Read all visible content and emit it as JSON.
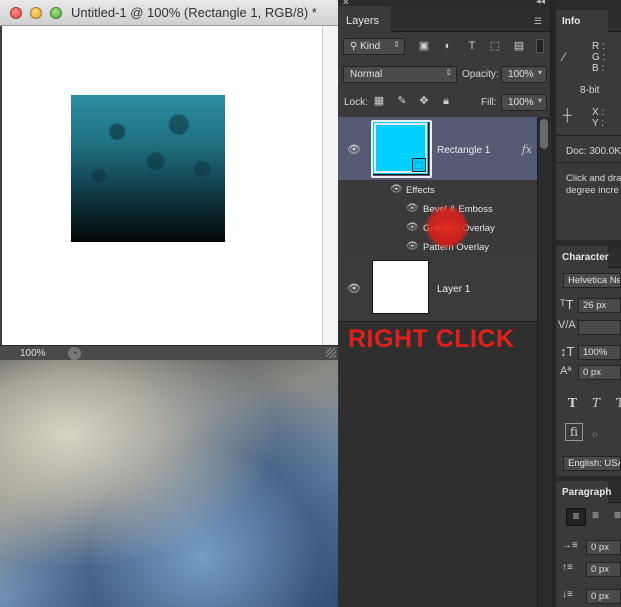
{
  "document": {
    "title": "Untitled-1 @ 100% (Rectangle 1, RGB/8) *",
    "zoom": "100%"
  },
  "layers_panel": {
    "tab": "Layers",
    "filter_kind": "Kind",
    "blend_mode": "Normal",
    "opacity_label": "Opacity:",
    "opacity_value": "100%",
    "lock_label": "Lock:",
    "fill_label": "Fill:",
    "fill_value": "100%",
    "layers": [
      {
        "name": "Rectangle 1",
        "effects_label": "Effects",
        "effects": [
          "Bevel & Emboss",
          "Gradient Overlay",
          "Pattern Overlay"
        ]
      },
      {
        "name": "Layer 1"
      }
    ]
  },
  "annotation": {
    "text": "RIGHT CLICK"
  },
  "info_panel": {
    "tab": "Info",
    "rgb_labels": [
      "R :",
      "G :",
      "B :"
    ],
    "bit_depth": "8-bit",
    "xy_labels": [
      "X :",
      "Y :"
    ],
    "doc_size": "Doc: 300.0K",
    "hint_line1": "Click and dra",
    "hint_line2": "degree incre"
  },
  "character_panel": {
    "tab": "Character",
    "font_family": "Helvetica Ne",
    "font_size": "26 px",
    "scale": "100%",
    "baseline": "0 px",
    "language": "English: USA"
  },
  "paragraph_panel": {
    "tab": "Paragraph",
    "indents": [
      "0 px",
      "0 px",
      "0 px"
    ]
  }
}
